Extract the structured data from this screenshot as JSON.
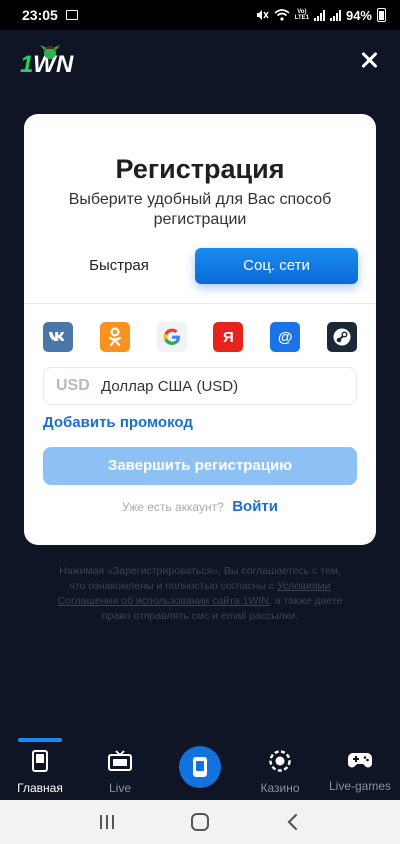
{
  "status_bar": {
    "time": "23:05",
    "battery": "94%",
    "network": "LTE1",
    "volte": "Vo)"
  },
  "header": {
    "logo": "1WIN"
  },
  "registration": {
    "title": "Регистрация",
    "subtitle": "Выберите удобный для Вас способ регистрации",
    "tabs": [
      {
        "label": "Быстрая",
        "active": false
      },
      {
        "label": "Соц. сети",
        "active": true
      }
    ],
    "socials": [
      {
        "name": "vk",
        "label": "vk"
      },
      {
        "name": "odnoklassniki",
        "label": "ok"
      },
      {
        "name": "google",
        "label": "G"
      },
      {
        "name": "yandex",
        "label": "Я"
      },
      {
        "name": "mail",
        "label": "@"
      },
      {
        "name": "steam",
        "label": "steam"
      }
    ],
    "currency": {
      "code": "USD",
      "name": "Доллар США (USD)"
    },
    "promo_label": "Добавить промокод",
    "submit_label": "Завершить регистрацию",
    "login_question": "Уже есть аккаунт?",
    "login_link": "Войти"
  },
  "terms": {
    "part1": "Нажимая «Зарегистрироваться», Вы соглашаетесь с тем, что ознакомлены и полностью согласны с ",
    "link": "Условиями Соглашения об использовании сайта 1WIN",
    "part2": ", а также даете право отправлять смс и email рассылки."
  },
  "bottom_nav": [
    {
      "label": "Главная",
      "icon": "home-phone-icon",
      "active": true
    },
    {
      "label": "Live",
      "icon": "tv-icon",
      "active": false
    },
    {
      "label": "",
      "icon": "slot-machine-icon",
      "active": false
    },
    {
      "label": "Казино",
      "icon": "casino-chip-icon",
      "active": false
    },
    {
      "label": "Live-games",
      "icon": "gamepad-icon",
      "active": false
    }
  ],
  "colors": {
    "background": "#0f1525",
    "accent": "#1a8cf0",
    "link": "#1a6fcf",
    "submit_disabled": "#8ec1f3"
  }
}
